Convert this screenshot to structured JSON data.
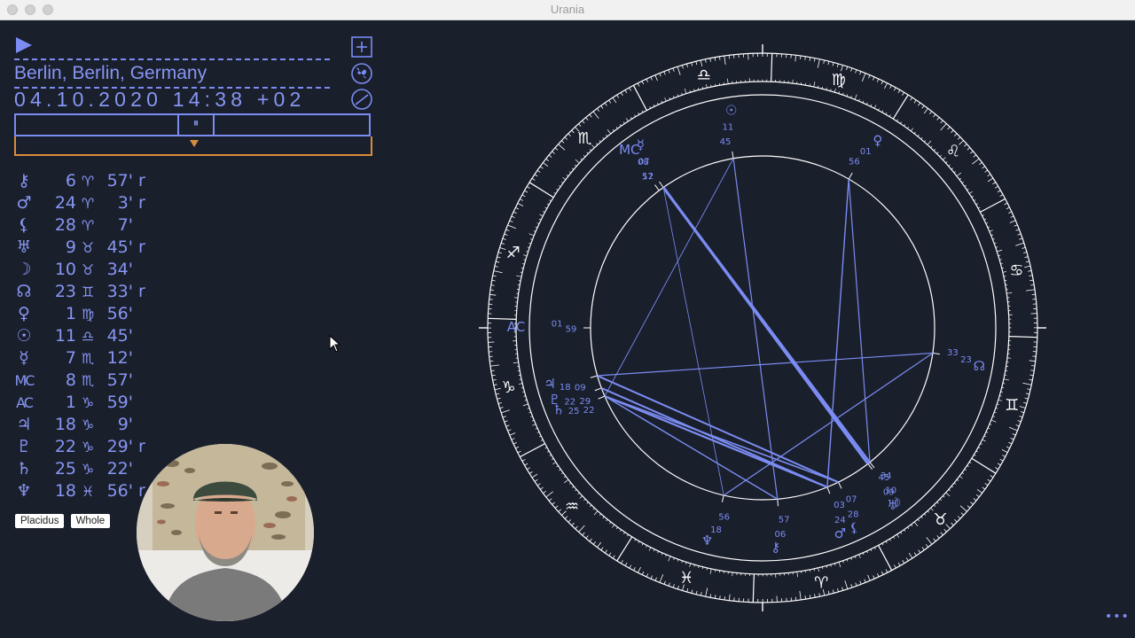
{
  "window": {
    "title": "Urania"
  },
  "panel": {
    "location": "Berlin, Berlin, Germany",
    "datetime": "04.10.2020 14:38 +02",
    "pause_symbol": "⏸",
    "icons": {
      "play": "play-icon",
      "add": "plus-icon",
      "globe": "globe-icon",
      "compass": "compass-icon"
    }
  },
  "planets": [
    {
      "name": "chiron",
      "symbol": "⚷",
      "deg": "6",
      "sign": "♈",
      "min": "57'",
      "retro": "r"
    },
    {
      "name": "mars",
      "symbol": "♂",
      "deg": "24",
      "sign": "♈",
      "min": "3'",
      "retro": "r"
    },
    {
      "name": "lilith",
      "symbol": "⚸",
      "deg": "28",
      "sign": "♈",
      "min": "7'",
      "retro": ""
    },
    {
      "name": "uranus",
      "symbol": "♅",
      "deg": "9",
      "sign": "♉",
      "min": "45'",
      "retro": "r"
    },
    {
      "name": "moon",
      "symbol": "☽",
      "deg": "10",
      "sign": "♉",
      "min": "34'",
      "retro": ""
    },
    {
      "name": "node",
      "symbol": "☊",
      "deg": "23",
      "sign": "♊",
      "min": "33'",
      "retro": "r"
    },
    {
      "name": "venus",
      "symbol": "♀",
      "deg": "1",
      "sign": "♍",
      "min": "56'",
      "retro": ""
    },
    {
      "name": "sun",
      "symbol": "☉",
      "deg": "11",
      "sign": "♎",
      "min": "45'",
      "retro": ""
    },
    {
      "name": "mercury",
      "symbol": "☿",
      "deg": "7",
      "sign": "♏",
      "min": "12'",
      "retro": ""
    },
    {
      "name": "mc",
      "symbol": "MC",
      "deg": "8",
      "sign": "♏",
      "min": "57'",
      "retro": ""
    },
    {
      "name": "ac",
      "symbol": "AC",
      "deg": "1",
      "sign": "♑",
      "min": "59'",
      "retro": ""
    },
    {
      "name": "jupiter",
      "symbol": "♃",
      "deg": "18",
      "sign": "♑",
      "min": "9'",
      "retro": ""
    },
    {
      "name": "pluto",
      "symbol": "♇",
      "deg": "22",
      "sign": "♑",
      "min": "29'",
      "retro": "r"
    },
    {
      "name": "saturn",
      "symbol": "♄",
      "deg": "25",
      "sign": "♑",
      "min": "22'",
      "retro": ""
    },
    {
      "name": "neptune",
      "symbol": "♆",
      "deg": "18",
      "sign": "♓",
      "min": "56'",
      "retro": "r"
    }
  ],
  "house_systems": {
    "placidus": "Placidus",
    "whole": "Whole"
  },
  "wheel": {
    "ac_label": "AC",
    "mc_label": "MC",
    "signs": [
      {
        "glyph": "♑",
        "lon": 270
      },
      {
        "glyph": "♒",
        "lon": 300
      },
      {
        "glyph": "♓",
        "lon": 330
      },
      {
        "glyph": "♈",
        "lon": 0
      },
      {
        "glyph": "♉",
        "lon": 30
      },
      {
        "glyph": "♊",
        "lon": 60
      },
      {
        "glyph": "♋",
        "lon": 90
      },
      {
        "glyph": "♌",
        "lon": 120
      },
      {
        "glyph": "♍",
        "lon": 150
      },
      {
        "glyph": "♎",
        "lon": 180
      },
      {
        "glyph": "♏",
        "lon": 210
      },
      {
        "glyph": "♐",
        "lon": 240
      }
    ],
    "labels": [
      {
        "text": "01",
        "lon": 271.9
      },
      {
        "text": "59",
        "lon": 271.9
      },
      {
        "text": "♃",
        "lon": 288.2
      },
      {
        "text": "18",
        "lon": 288.2
      },
      {
        "text": "09",
        "lon": 288.2
      },
      {
        "text": "♇",
        "lon": 292.5
      },
      {
        "text": "22",
        "lon": 292.5
      },
      {
        "text": "29",
        "lon": 292.5
      },
      {
        "text": "♄",
        "lon": 295.4
      },
      {
        "text": "25",
        "lon": 295.4
      },
      {
        "text": "22",
        "lon": 295.4
      },
      {
        "text": "♆",
        "lon": 348.9
      },
      {
        "text": "18",
        "lon": 348.9
      },
      {
        "text": "56",
        "lon": 348.9
      },
      {
        "text": "⚷",
        "lon": 6.9
      },
      {
        "text": "06",
        "lon": 6.9
      },
      {
        "text": "57",
        "lon": 6.9
      },
      {
        "text": "♂",
        "lon": 24.1
      },
      {
        "text": "24",
        "lon": 24.1
      },
      {
        "text": "03",
        "lon": 24.1
      },
      {
        "text": "⚸",
        "lon": 28.1
      },
      {
        "text": "28",
        "lon": 28.1
      },
      {
        "text": "07",
        "lon": 28.1
      },
      {
        "text": "♅",
        "lon": 39.8
      },
      {
        "text": "09",
        "lon": 39.8
      },
      {
        "text": "45",
        "lon": 39.8
      },
      {
        "text": "☽",
        "lon": 40.6
      },
      {
        "text": "10",
        "lon": 40.6
      },
      {
        "text": "34",
        "lon": 40.6
      },
      {
        "text": "☊",
        "lon": 83.5
      },
      {
        "text": "23",
        "lon": 83.5
      },
      {
        "text": "33",
        "lon": 83.5
      },
      {
        "text": "♀",
        "lon": 151.9
      },
      {
        "text": "01",
        "lon": 151.9
      },
      {
        "text": "56",
        "lon": 151.9
      },
      {
        "text": "☉",
        "lon": 191.7
      },
      {
        "text": "11",
        "lon": 191.7
      },
      {
        "text": "45",
        "lon": 191.7
      },
      {
        "text": "☿",
        "lon": 217.2
      },
      {
        "text": "07",
        "lon": 217.2
      },
      {
        "text": "12",
        "lon": 217.2
      },
      {
        "text": "08",
        "lon": 218.9
      },
      {
        "text": "57",
        "lon": 218.9
      }
    ]
  }
}
